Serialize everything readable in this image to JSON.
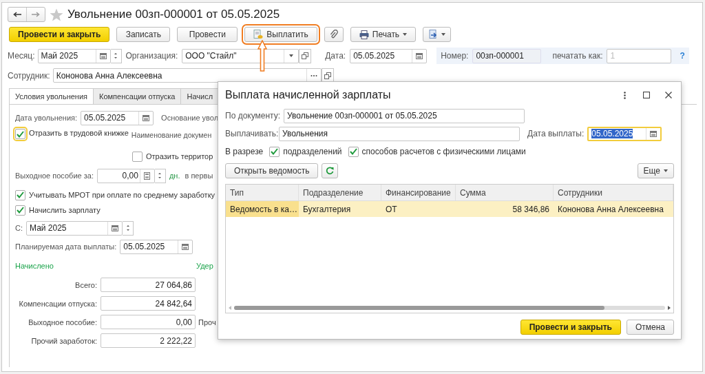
{
  "window": {
    "title": "Увольнение 00зп-000001 от 05.05.2025",
    "favorite": false
  },
  "toolbar": [
    {
      "label": "Провести и закрыть",
      "kind": "primary"
    },
    {
      "label": "Записать",
      "kind": "plain"
    },
    {
      "label": "Провести",
      "kind": "plain"
    },
    {
      "label": "Выплатить",
      "kind": "payout",
      "highlighted": true
    },
    {
      "kind": "attach"
    },
    {
      "label": "Печать",
      "kind": "print"
    },
    {
      "kind": "export"
    }
  ],
  "month": {
    "label": "Месяц:",
    "value": "Май 2025"
  },
  "organization": {
    "label": "Организация:",
    "value": "ООО \"Стайл\""
  },
  "date": {
    "label": "Дата:",
    "value": "05.05.2025"
  },
  "number": {
    "label": "Номер:",
    "value": "00зп-000001"
  },
  "print_as": {
    "label": "печатать как:",
    "placeholder": "1"
  },
  "help": "?",
  "employee": {
    "label": "Сотрудник:",
    "value": "Кононова Анна Алексеевна"
  },
  "tabs": [
    {
      "label": "Условия увольнения",
      "selected": true
    },
    {
      "label": "Компенсации отпуска",
      "selected": false
    },
    {
      "label": "Начисл",
      "selected": false
    }
  ],
  "terms": {
    "dismissal_date": {
      "label": "Дата увольнения:",
      "value": "05.05.2025"
    },
    "basis_label": "Основание увол",
    "work_book": {
      "label": "Отразить в трудовой книжке",
      "checked": true,
      "focused": true
    },
    "doc_name_label": "Наименование докумен",
    "territorial": {
      "label": "Отразить территор",
      "checked": false
    },
    "severance": {
      "label": "Выходное пособие за:",
      "value": "0,00",
      "unit": "дн.",
      "note": "в первы"
    },
    "mrot": {
      "label": "Учитывать МРОТ при оплате по среднему заработку",
      "checked": true
    },
    "accrue": {
      "label": "Начислить зарплату",
      "checked": true
    },
    "from": {
      "label": "С:",
      "value": "Май 2025"
    },
    "planned_date": {
      "label": "Планируемая дата выплаты:",
      "value": "05.05.2025"
    },
    "accrued_heading": "Начислено",
    "withheld_heading": "Удер",
    "totals": [
      {
        "label": "Всего:",
        "value": "27 064,86"
      },
      {
        "label": "Компенсации отпуска:",
        "value": "24 842,64"
      },
      {
        "label": "Выходное пособие:",
        "value": "0,00",
        "side_label": "Проч"
      },
      {
        "label": "Прочий заработок:",
        "value": "2 222,22"
      }
    ]
  },
  "dialog": {
    "title": "Выплата начисленной зарплаты",
    "document": {
      "label": "По документу:",
      "value": "Увольнение 00зп-000001 от 05.05.2025"
    },
    "pay": {
      "label": "Выплачивать:",
      "value": "Увольнения"
    },
    "pay_date": {
      "label": "Дата выплаты:",
      "value": "05.05.2025",
      "text_selected": true
    },
    "breakdown_label": "В разрезе",
    "options": [
      {
        "label": "подразделений",
        "checked": true
      },
      {
        "label": "способов расчетов с физическими лицами",
        "checked": true
      }
    ],
    "open_button": "Открыть ведомость",
    "more_button": "Еще",
    "table": {
      "columns": [
        "Тип",
        "Подразделение",
        "Финансирование",
        "Сумма",
        "Сотрудники"
      ],
      "rows": [
        {
          "cells": [
            "Ведомость в ка…",
            "Бухгалтерия",
            "ОТ",
            "58 346,86",
            "Кононова Анна Алексеевна"
          ],
          "selected": true
        }
      ]
    },
    "buttons": [
      {
        "label": "Провести и закрыть",
        "kind": "primary"
      },
      {
        "label": "Отмена",
        "kind": "plain"
      }
    ]
  }
}
